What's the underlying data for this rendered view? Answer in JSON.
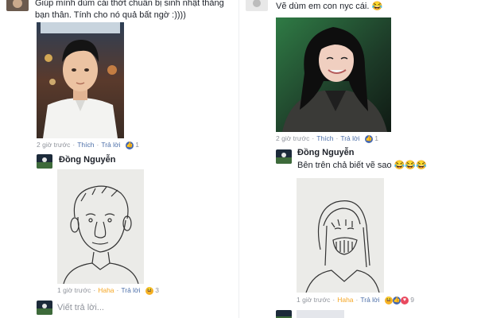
{
  "left": {
    "post_text_line1": "Giúp mình dùm cái thớt chuẩn bị sinh nhật thằng",
    "post_text_line2": "bạn thân. Tính cho nó quả bất ngờ :))))",
    "post_meta": {
      "time": "2 giờ trước",
      "like": "Thích",
      "reply": "Trả lời",
      "count": "1"
    },
    "reply": {
      "author": "Đồng Nguyễn",
      "meta": {
        "time": "1 giờ trước",
        "reaction": "Haha",
        "reply": "Trả lời",
        "count": "3"
      }
    },
    "reply_input_placeholder": "Viết trả lời..."
  },
  "right": {
    "post_text": "Vẽ dùm em con nyc cái.",
    "post_emoji": "😂",
    "post_meta": {
      "time": "2 giờ trước",
      "like": "Thích",
      "reply": "Trả lời",
      "count": "1"
    },
    "reply": {
      "author": "Đồng Nguyễn",
      "text": "Bên trên chả biết vẽ sao",
      "emoji": "😂😂😂",
      "meta": {
        "time": "1 giờ trước",
        "reaction": "Haha",
        "reply": "Trả lời",
        "count": "9"
      }
    }
  },
  "icons": {
    "like": "like-icon",
    "haha": "haha-icon",
    "love": "love-icon"
  },
  "colors": {
    "link": "#4b6ea8",
    "meta": "#90949c",
    "haha": "#f5a623",
    "like_badge": "#4267b2",
    "love_badge": "#e9495e"
  }
}
